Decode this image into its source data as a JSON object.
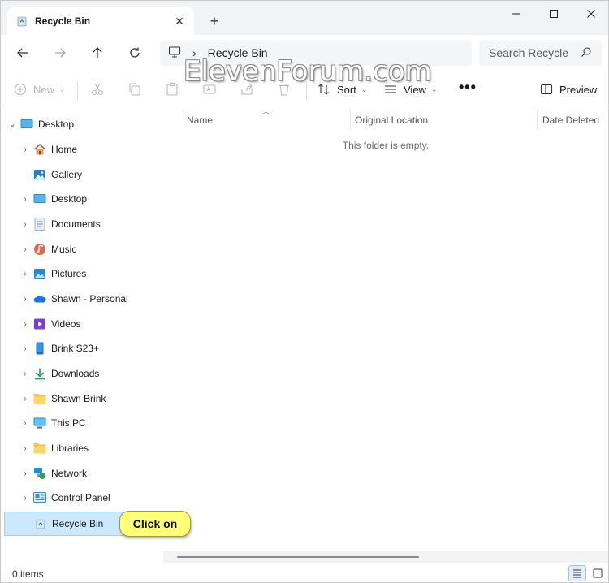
{
  "window": {
    "tab_title": "Recycle Bin",
    "new_tab_symbol": "+",
    "close_tab_symbol": "✕"
  },
  "address": {
    "breadcrumb": "Recycle Bin",
    "search_placeholder": "Search Recycle"
  },
  "watermark": "ElevenForum.com",
  "command_bar": {
    "new_label": "New",
    "sort_label": "Sort",
    "view_label": "View",
    "more_label": "•••",
    "preview_label": "Preview"
  },
  "nav": {
    "items": [
      {
        "label": "Desktop",
        "icon": "desktop-icon",
        "expanded": true
      },
      {
        "label": "Home",
        "icon": "home-icon"
      },
      {
        "label": "Gallery",
        "icon": "gallery-icon"
      },
      {
        "label": "Desktop",
        "icon": "desktop-icon"
      },
      {
        "label": "Documents",
        "icon": "documents-icon"
      },
      {
        "label": "Music",
        "icon": "music-icon"
      },
      {
        "label": "Pictures",
        "icon": "pictures-icon"
      },
      {
        "label": "Shawn - Personal",
        "icon": "onedrive-icon"
      },
      {
        "label": "Videos",
        "icon": "videos-icon"
      },
      {
        "label": "Brink S23+",
        "icon": "phone-icon"
      },
      {
        "label": "Downloads",
        "icon": "downloads-icon"
      },
      {
        "label": "Shawn Brink",
        "icon": "folder-icon"
      },
      {
        "label": "This PC",
        "icon": "this-pc-icon"
      },
      {
        "label": "Libraries",
        "icon": "libraries-icon"
      },
      {
        "label": "Network",
        "icon": "network-icon"
      },
      {
        "label": "Control Panel",
        "icon": "control-panel-icon"
      },
      {
        "label": "Recycle Bin",
        "icon": "recycle-bin-icon",
        "selected": true
      }
    ]
  },
  "columns": {
    "name": "Name",
    "original_location": "Original Location",
    "date_deleted": "Date Deleted"
  },
  "content": {
    "empty_message": "This folder is empty."
  },
  "status": {
    "item_count": "0 items"
  },
  "callout": {
    "text": "Click on"
  },
  "colors": {
    "selection_bg": "#cce8ff",
    "selection_border": "#99d1ff",
    "callout_bg": "#ffff7a",
    "accent": "#0067c0"
  }
}
